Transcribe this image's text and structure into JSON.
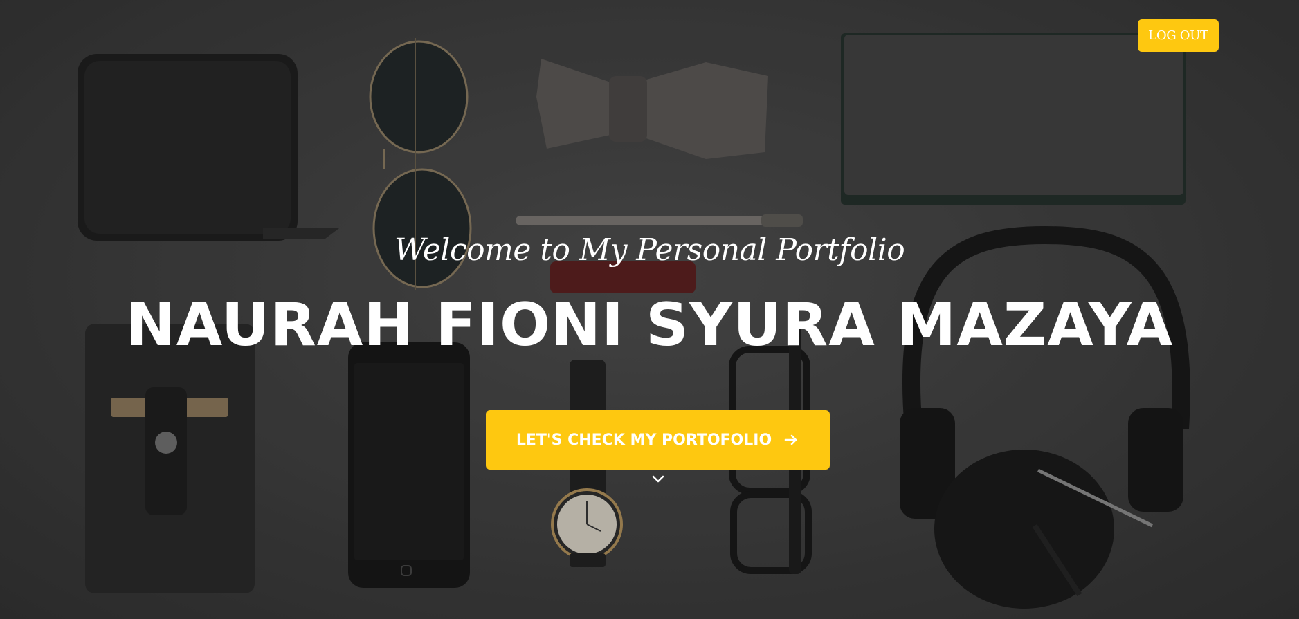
{
  "header": {
    "logout_label": "LOG OUT"
  },
  "hero": {
    "subtitle": "Welcome to My Personal Portfolio",
    "title": "NAURAH FIONI SYURA MAZAYA",
    "cta_label": "LET'S CHECK MY PORTOFOLIO",
    "cta_icon": "arrow-right-icon",
    "scroll_icon": "chevron-down-icon"
  },
  "colors": {
    "accent": "#fec810",
    "text": "#ffffff",
    "background": "#3a3a3a"
  }
}
